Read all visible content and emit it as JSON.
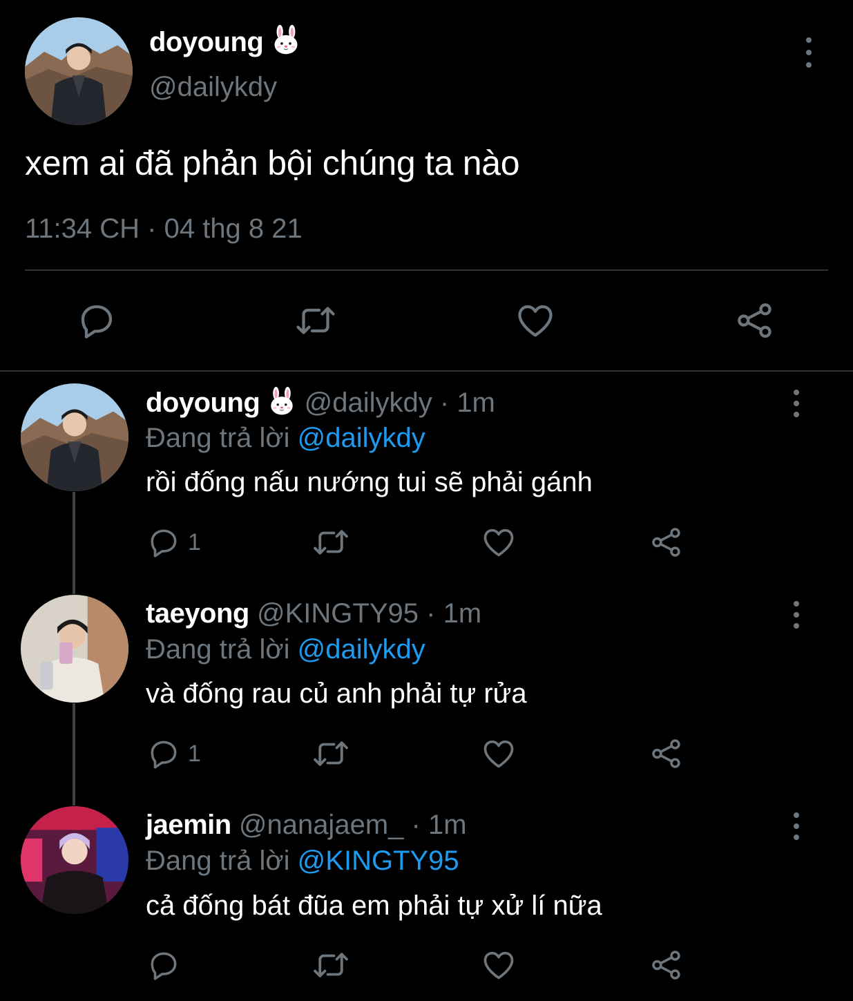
{
  "main_tweet": {
    "display_name": "doyoung",
    "name_emoji": "rabbit-face-emoji",
    "handle": "@dailykdy",
    "text": "xem ai đã phản bội chúng ta nào",
    "time": "11:34 CH",
    "separator": "·",
    "date": "04 thg 8 21",
    "actions": [
      "reply-icon",
      "retweet-icon",
      "like-icon",
      "share-icon"
    ]
  },
  "replies": [
    {
      "display_name": "doyoung",
      "name_emoji": "rabbit-face-emoji",
      "handle": "@dailykdy",
      "separator": "·",
      "time": "1m",
      "replying_prefix": "Đang trả lời",
      "replying_to": "@dailykdy",
      "text": "rồi đống nấu nướng tui sẽ phải gánh",
      "reply_count": "1"
    },
    {
      "display_name": "taeyong",
      "handle": "@KINGTY95",
      "separator": "·",
      "time": "1m",
      "replying_prefix": "Đang trả lời",
      "replying_to": "@dailykdy",
      "text": "và đống rau củ anh phải tự rửa",
      "reply_count": "1"
    },
    {
      "display_name": "jaemin",
      "handle": "@nanajaem_",
      "separator": "·",
      "time": "1m",
      "replying_prefix": "Đang trả lời",
      "replying_to": "@KINGTY95",
      "text": "cả đống bát đũa em phải tự xử lí nữa",
      "reply_count": ""
    }
  ],
  "colors": {
    "background": "#000000",
    "text_primary": "#ffffff",
    "text_secondary": "#6e767d",
    "mention": "#1d9bf0",
    "divider": "#2f3336"
  }
}
